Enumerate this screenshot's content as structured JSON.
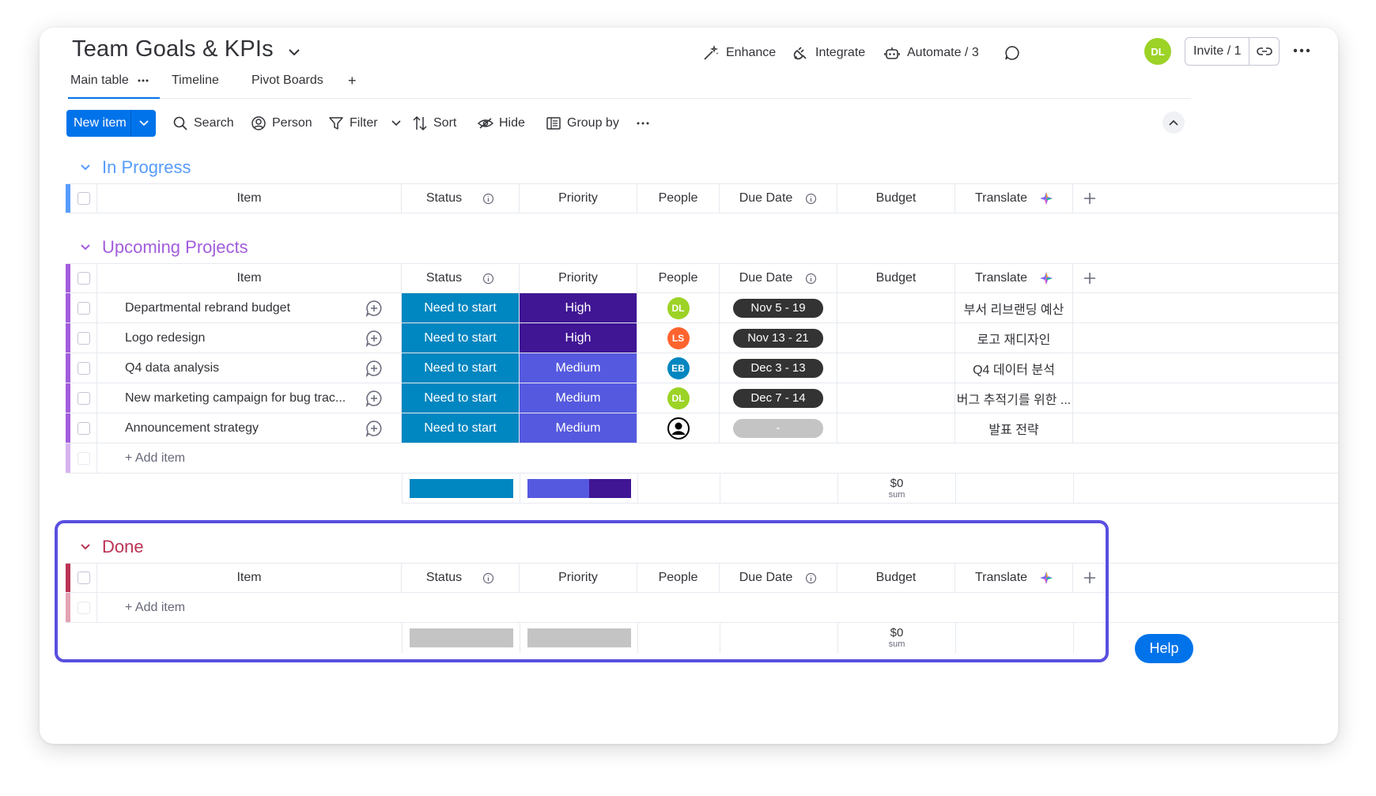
{
  "board": {
    "title": "Team Goals & KPIs"
  },
  "header_actions": {
    "enhance": "Enhance",
    "integrate": "Integrate",
    "automate": "Automate / 3",
    "avatar_initials": "DL",
    "invite": "Invite / 1"
  },
  "tabs": {
    "main": "Main table",
    "timeline": "Timeline",
    "pivot": "Pivot Boards",
    "add": "+"
  },
  "toolbar": {
    "new_item": "New item",
    "search": "Search",
    "person": "Person",
    "filter": "Filter",
    "sort": "Sort",
    "hide": "Hide",
    "group_by": "Group by"
  },
  "columns": {
    "item": "Item",
    "status": "Status",
    "priority": "Priority",
    "people": "People",
    "due_date": "Due Date",
    "budget": "Budget",
    "translate": "Translate"
  },
  "groups": {
    "in_progress": {
      "title": "In Progress",
      "color": "#579bfc"
    },
    "upcoming": {
      "title": "Upcoming Projects",
      "color": "#a25ddc",
      "rows": [
        {
          "name": "Departmental rebrand budget",
          "status": "Need to start",
          "priority": "High",
          "person": "DL",
          "person_color": "#9cd326",
          "due": "Nov 5 - 19",
          "translate": "부서 리브랜딩 예산"
        },
        {
          "name": "Logo redesign",
          "status": "Need to start",
          "priority": "High",
          "person": "LS",
          "person_color": "#ff642e",
          "due": "Nov 13 - 21",
          "translate": "로고 재디자인"
        },
        {
          "name": "Q4 data analysis",
          "status": "Need to start",
          "priority": "Medium",
          "person": "EB",
          "person_color": "#0086c0",
          "due": "Dec 3 - 13",
          "translate": "Q4 데이터 분석"
        },
        {
          "name": "New marketing campaign for bug trac...",
          "status": "Need to start",
          "priority": "Medium",
          "person": "DL",
          "person_color": "#9cd326",
          "due": "Dec 7 - 14",
          "translate": "버그 추적기를 위한 ..."
        },
        {
          "name": "Announcement strategy",
          "status": "Need to start",
          "priority": "Medium",
          "person": "",
          "person_color": "",
          "due": "-",
          "translate": "발표 전략"
        }
      ],
      "add_item": "+ Add item",
      "budget_sum": "$0",
      "sum_label": "sum",
      "priority_split": {
        "medium": 0.6,
        "high": 0.4
      }
    },
    "done": {
      "title": "Done",
      "color": "#bb3354",
      "add_item": "+ Add item",
      "budget_sum": "$0",
      "sum_label": "sum"
    }
  },
  "help": "Help"
}
